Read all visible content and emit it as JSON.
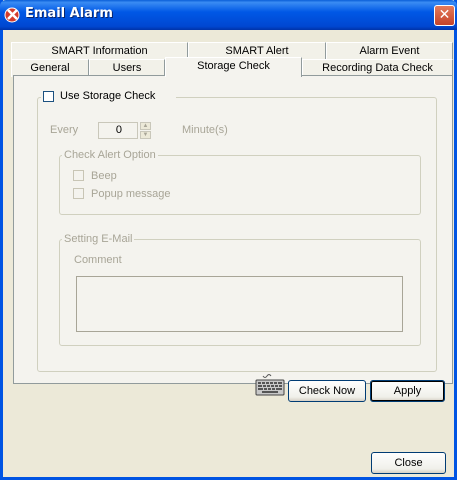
{
  "window": {
    "title": "Email Alarm",
    "close_glyph": "✕"
  },
  "tabs_row1": [
    {
      "label": "SMART Information"
    },
    {
      "label": "SMART Alert"
    },
    {
      "label": "Alarm Event"
    }
  ],
  "tabs_row2": [
    {
      "label": "General"
    },
    {
      "label": "Users"
    },
    {
      "label": "Storage Check",
      "active": true
    },
    {
      "label": "Recording Data Check"
    }
  ],
  "storage": {
    "use_label": "Use Storage Check",
    "use_checked": false,
    "every_label": "Every",
    "every_value": "0",
    "unit_label": "Minute(s)"
  },
  "alert_option": {
    "title": "Check Alert Option",
    "beep_label": "Beep",
    "beep_checked": false,
    "popup_label": "Popup message",
    "popup_checked": false
  },
  "email": {
    "title": "Setting E-Mail",
    "comment_label": "Comment",
    "comment_value": ""
  },
  "buttons": {
    "check_now": "Check Now",
    "apply": "Apply",
    "close": "Close"
  },
  "icons": {
    "title_icon": "app-logo-icon",
    "keyboard": "keyboard-icon"
  },
  "colors": {
    "titlebar": "#0054e3",
    "face": "#ece9d8",
    "panel": "#f4f3ee",
    "disabled_text": "#a8a597"
  }
}
